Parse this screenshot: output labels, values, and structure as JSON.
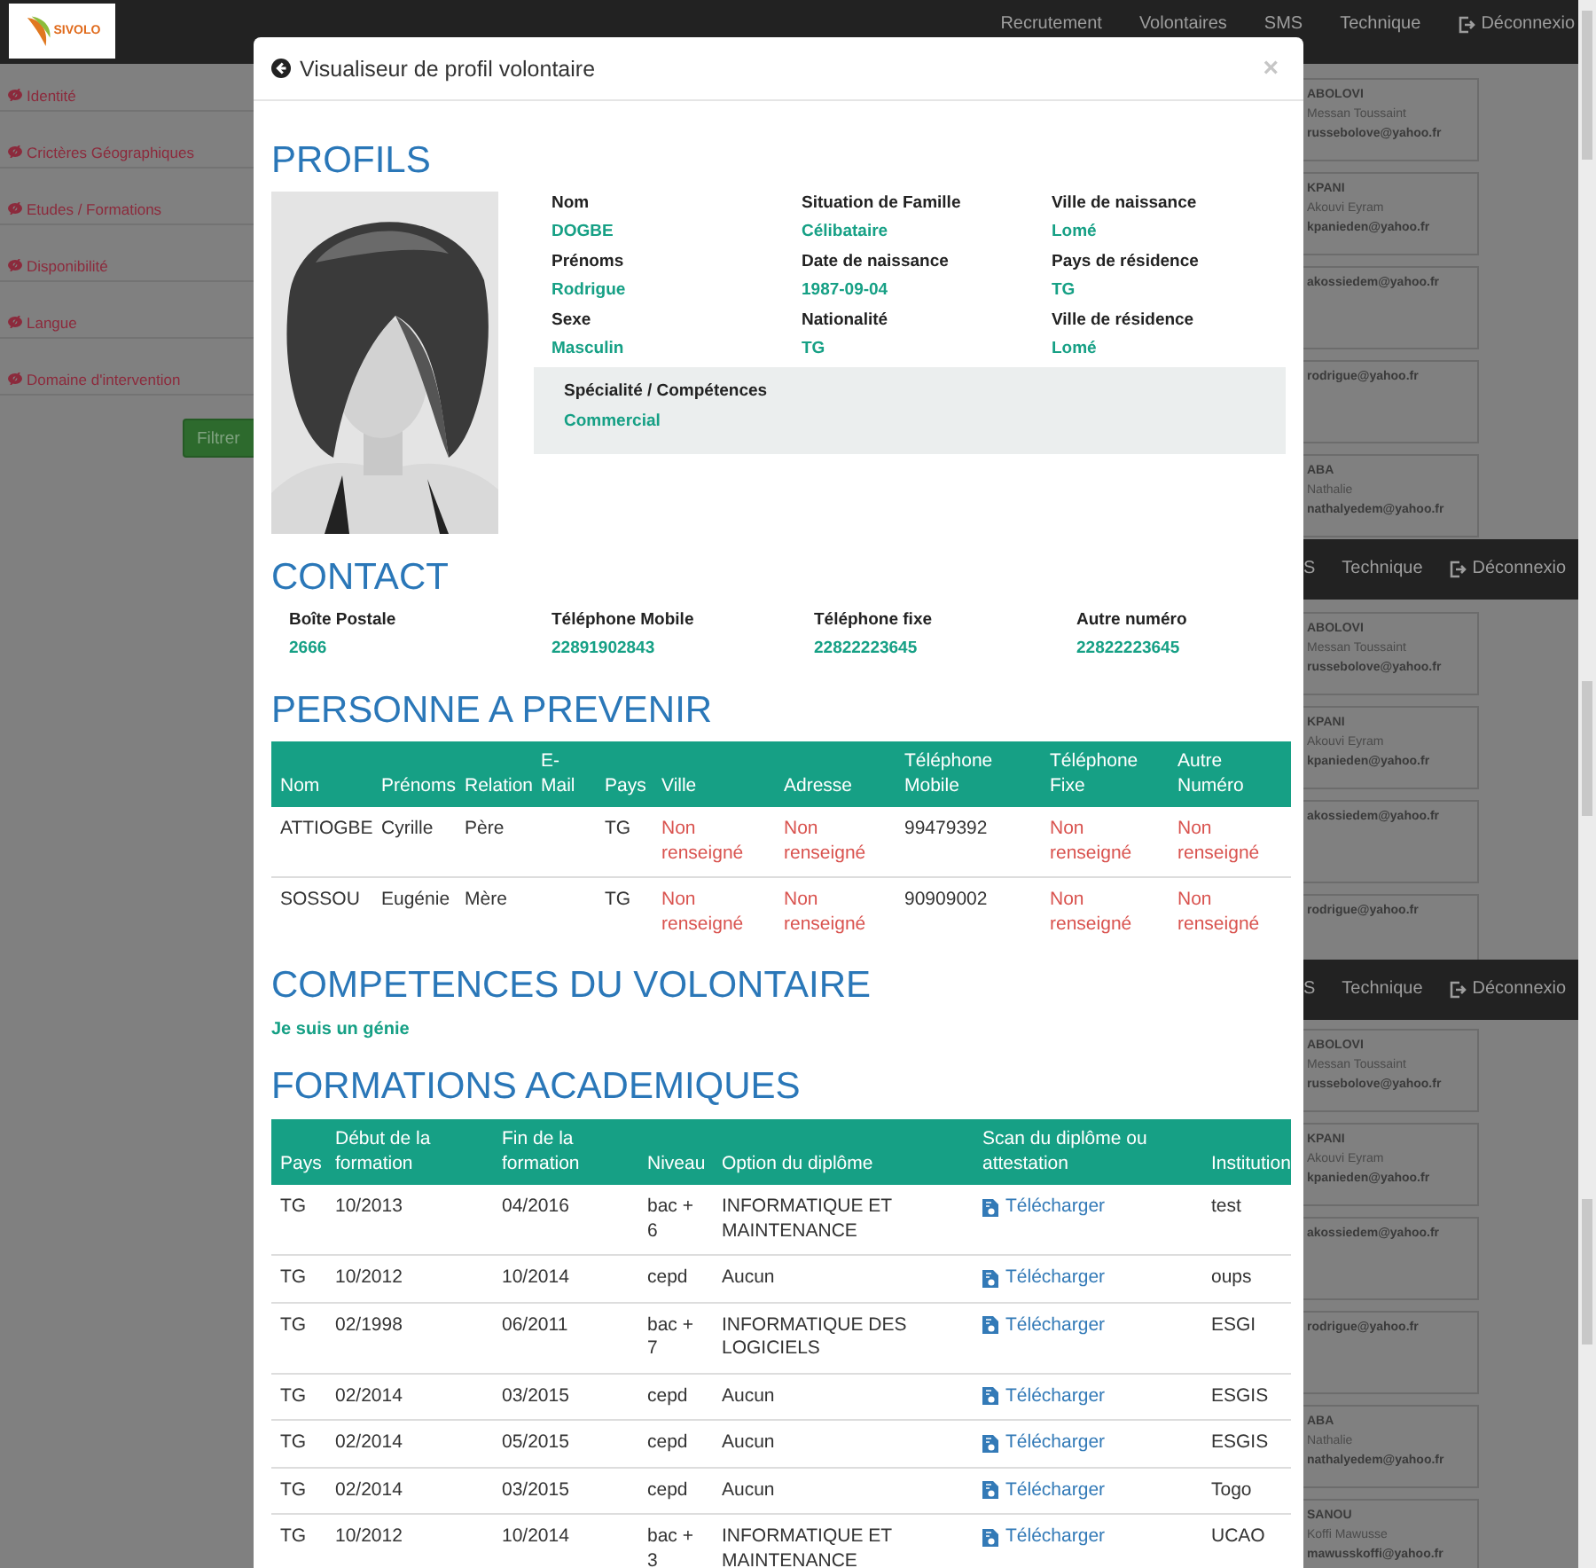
{
  "navbar": {
    "logo": "SIVOLO",
    "links": [
      {
        "label": "Recrutement",
        "kind": "link"
      },
      {
        "label": "Volontaires",
        "kind": "link"
      },
      {
        "label": "SMS",
        "kind": "link"
      },
      {
        "label": "Technique",
        "kind": "link"
      },
      {
        "label": "Déconnexio",
        "kind": "logout"
      }
    ]
  },
  "sidebar": {
    "filters": [
      "Identité",
      "Crictères Géographiques",
      "Etudes / Formations",
      "Disponibilité",
      "Langue",
      "Domaine d'intervention"
    ],
    "button": "Filtrer"
  },
  "results": [
    {
      "cards": [
        {
          "name": "ABOLOVI",
          "first_names": "Messan Toussaint",
          "email": "russebolove@yahoo.fr"
        },
        {
          "name": "KPANI",
          "first_names": "Akouvi Eyram",
          "email": "kpanieden@yahoo.fr"
        },
        {
          "email": "akossiedem@yahoo.fr"
        },
        {
          "email": "rodrigue@yahoo.fr"
        },
        {
          "name": "ABA",
          "first_names": "Nathalie",
          "email": "nathalyedem@yahoo.fr"
        }
      ]
    },
    {
      "navbar_links": [
        {
          "label": "S",
          "kind": "link"
        },
        {
          "label": "Technique",
          "kind": "link"
        },
        {
          "label": "Déconnexio",
          "kind": "logout"
        }
      ],
      "cards": [
        {
          "name": "ABOLOVI",
          "first_names": "Messan Toussaint",
          "email": "russebolove@yahoo.fr"
        },
        {
          "name": "KPANI",
          "first_names": "Akouvi Eyram",
          "email": "kpanieden@yahoo.fr"
        },
        {
          "email": "akossiedem@yahoo.fr"
        },
        {
          "email": "rodrigue@yahoo.fr"
        }
      ]
    },
    {
      "navbar_links": [
        {
          "label": "S",
          "kind": "link"
        },
        {
          "label": "Technique",
          "kind": "link"
        },
        {
          "label": "Déconnexio",
          "kind": "logout"
        }
      ],
      "cards": [
        {
          "name": "ABOLOVI",
          "first_names": "Messan Toussaint",
          "email": "russebolove@yahoo.fr"
        },
        {
          "name": "KPANI",
          "first_names": "Akouvi Eyram",
          "email": "kpanieden@yahoo.fr"
        },
        {
          "email": "akossiedem@yahoo.fr"
        },
        {
          "email": "rodrigue@yahoo.fr"
        },
        {
          "name": "ABA",
          "first_names": "Nathalie",
          "email": "nathalyedem@yahoo.fr"
        },
        {
          "name": "SANOU",
          "first_names": "Koffi Mawusse",
          "email": "mawusskoffi@yahoo.fr"
        }
      ]
    }
  ],
  "modal": {
    "title": "Visualiseur de profil volontaire",
    "close": "×",
    "profile": {
      "heading": "PROFILS",
      "fields": [
        {
          "label": "Nom",
          "value": "DOGBE"
        },
        {
          "label": "Situation de Famille",
          "value": "Célibataire"
        },
        {
          "label": "Ville de naissance",
          "value": "Lomé"
        },
        {
          "label": "Prénoms",
          "value": "Rodrigue"
        },
        {
          "label": "Date de naissance",
          "value": "1987-09-04"
        },
        {
          "label": "Pays de résidence",
          "value": "TG"
        },
        {
          "label": "Sexe",
          "value": "Masculin"
        },
        {
          "label": "Nationalité",
          "value": "TG"
        },
        {
          "label": "Ville de résidence",
          "value": "Lomé"
        }
      ],
      "speciality": {
        "label": "Spécialité / Compétences",
        "value": "Commercial"
      }
    },
    "contact": {
      "heading": "CONTACT",
      "fields": [
        {
          "label": "Boîte Postale",
          "value": "2666"
        },
        {
          "label": "Téléphone Mobile",
          "value": "22891902843"
        },
        {
          "label": "Téléphone fixe",
          "value": "22822223645"
        },
        {
          "label": "Autre numéro",
          "value": "22822223645"
        }
      ]
    },
    "emergency": {
      "heading": "PERSONNE A PREVENIR",
      "columns": [
        "Nom",
        "Prénoms",
        "Relation",
        "E-Mail",
        "Pays",
        "Ville",
        "Adresse",
        "Téléphone Mobile",
        "Téléphone Fixe",
        "Autre Numéro"
      ],
      "rows": [
        [
          {
            "text": "ATTIOGBE",
            "missing": false
          },
          {
            "text": "Cyrille",
            "missing": false
          },
          {
            "text": "Père",
            "missing": false
          },
          null,
          {
            "text": "TG",
            "missing": false
          },
          {
            "text": "Non renseigné",
            "missing": true
          },
          {
            "text": "Non renseigné",
            "missing": true
          },
          {
            "text": "99479392",
            "missing": false
          },
          {
            "text": "Non renseigné",
            "missing": true
          },
          {
            "text": "Non renseigné",
            "missing": true
          }
        ],
        [
          {
            "text": "SOSSOU",
            "missing": false
          },
          {
            "text": "Eugénie",
            "missing": false
          },
          {
            "text": "Mère",
            "missing": false
          },
          null,
          {
            "text": "TG",
            "missing": false
          },
          {
            "text": "Non renseigné",
            "missing": true
          },
          {
            "text": "Non renseigné",
            "missing": true
          },
          {
            "text": "90909002",
            "missing": false
          },
          {
            "text": "Non renseigné",
            "missing": true
          },
          {
            "text": "Non renseigné",
            "missing": true
          }
        ]
      ]
    },
    "skills": {
      "heading": "COMPETENCES DU VOLONTAIRE",
      "text": "Je suis un génie"
    },
    "education": {
      "heading": "FORMATIONS ACADEMIQUES",
      "columns": [
        "Pays",
        "Début de la formation",
        "Fin de la formation",
        "Niveau",
        "Option du diplôme",
        "Scan du diplôme ou attestation",
        "Institution"
      ],
      "rows": [
        {
          "country": "TG",
          "start": "10/2013",
          "end": "04/2016",
          "degree_level": "bac + 6",
          "option": "INFORMATIQUE ET MAINTENANCE",
          "scan": "Télécharger",
          "institution": "test"
        },
        {
          "country": "TG",
          "start": "10/2012",
          "end": "10/2014",
          "degree_level": "cepd",
          "option": "Aucun",
          "scan": "Télécharger",
          "institution": "oups"
        },
        {
          "country": "TG",
          "start": "02/1998",
          "end": "06/2011",
          "degree_level": "bac + 7",
          "option": "INFORMATIQUE DES LOGICIELS",
          "scan": "Télécharger",
          "institution": "ESGI"
        },
        {
          "country": "TG",
          "start": "02/2014",
          "end": "03/2015",
          "degree_level": "cepd",
          "option": "Aucun",
          "scan": "Télécharger",
          "institution": "ESGIS"
        },
        {
          "country": "TG",
          "start": "02/2014",
          "end": "05/2015",
          "degree_level": "cepd",
          "option": "Aucun",
          "scan": "Télécharger",
          "institution": "ESGIS"
        },
        {
          "country": "TG",
          "start": "02/2014",
          "end": "03/2015",
          "degree_level": "cepd",
          "option": "Aucun",
          "scan": "Télécharger",
          "institution": "Togo"
        },
        {
          "country": "TG",
          "start": "10/2012",
          "end": "10/2014",
          "degree_level": "bac + 3",
          "option": "INFORMATIQUE ET MAINTENANCE",
          "scan": "Télécharger",
          "institution": "UCAO"
        }
      ]
    }
  }
}
